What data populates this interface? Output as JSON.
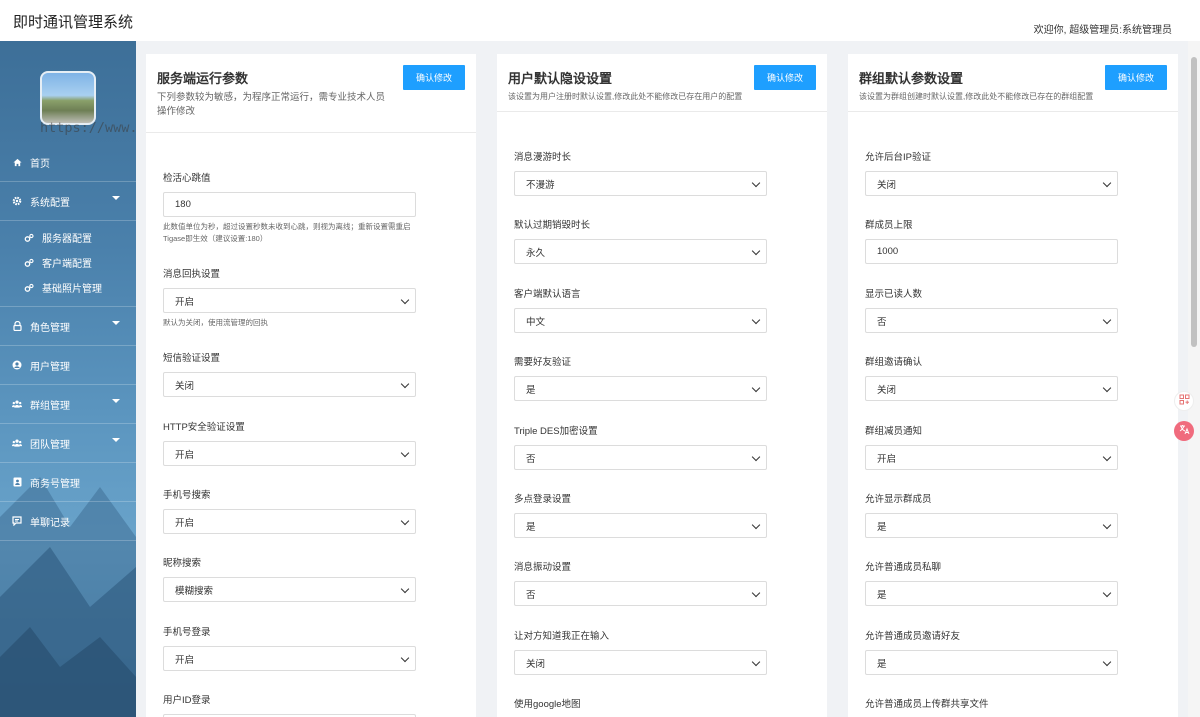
{
  "header": {
    "app_title": "即时通讯管理系统",
    "welcome": "欢迎你,  超级管理员:系统管理员"
  },
  "sidebar": {
    "watermark": "https://www.huzhan.com/ishop47990",
    "items": [
      {
        "label": "首页",
        "icon": "home-icon"
      },
      {
        "label": "系统配置",
        "icon": "gear-icon",
        "expanded": true
      },
      {
        "label": "角色管理",
        "icon": "lock-icon"
      },
      {
        "label": "用户管理",
        "icon": "user-icon"
      },
      {
        "label": "群组管理",
        "icon": "group-icon"
      },
      {
        "label": "团队管理",
        "icon": "team-icon"
      },
      {
        "label": "商务号管理",
        "icon": "contact-card-icon"
      },
      {
        "label": "单聊记录",
        "icon": "chat-icon"
      }
    ],
    "sub_items": [
      {
        "label": "服务器配置",
        "icon": "cogs-icon"
      },
      {
        "label": "客户端配置",
        "icon": "cogs-icon"
      },
      {
        "label": "基础照片管理",
        "icon": "cogs-icon"
      }
    ]
  },
  "panels": [
    {
      "title": "服务端运行参数",
      "desc": "下列参数较为敏感，为程序正常运行，需专业技术人员操作修改",
      "button": "确认修改",
      "fields": [
        {
          "label": "检活心跳值",
          "type": "input",
          "value": "180",
          "hint": "此数值单位为秒，超过设置秒数未收到心跳，则视为离线；重新设置需重启Tigase即生效（建议设置:180）"
        },
        {
          "label": "消息回执设置",
          "type": "select",
          "value": "开启",
          "hint": "默认为关闭，使用流管理的回执"
        },
        {
          "label": "短信验证设置",
          "type": "select",
          "value": "关闭"
        },
        {
          "label": "HTTP安全验证设置",
          "type": "select",
          "value": "开启"
        },
        {
          "label": "手机号搜索",
          "type": "select",
          "value": "开启"
        },
        {
          "label": "昵称搜索",
          "type": "select",
          "value": "模糊搜索"
        },
        {
          "label": "手机号登录",
          "type": "select",
          "value": "开启"
        },
        {
          "label": "用户ID登录",
          "type": "select",
          "value": ""
        }
      ]
    },
    {
      "title": "用户默认隐设设置",
      "desc": "该设置为用户注册时默认设置,修改此处不能修改已存在用户的配置",
      "button": "确认修改",
      "fields": [
        {
          "label": "消息漫游时长",
          "type": "select",
          "value": "不漫游"
        },
        {
          "label": "默认过期销毁时长",
          "type": "select",
          "value": "永久"
        },
        {
          "label": "客户端默认语言",
          "type": "select",
          "value": "中文"
        },
        {
          "label": "需要好友验证",
          "type": "select",
          "value": "是"
        },
        {
          "label": "Triple DES加密设置",
          "type": "select",
          "value": "否"
        },
        {
          "label": "多点登录设置",
          "type": "select",
          "value": "是"
        },
        {
          "label": "消息振动设置",
          "type": "select",
          "value": "否"
        },
        {
          "label": "让对方知道我正在输入",
          "type": "select",
          "value": "关闭"
        },
        {
          "label": "使用google地图",
          "type": "select",
          "value": ""
        }
      ]
    },
    {
      "title": "群组默认参数设置",
      "desc": "该设置为群组创建时默认设置,修改此处不能修改已存在的群组配置",
      "button": "确认修改",
      "fields": [
        {
          "label": "允许后台IP验证",
          "type": "select",
          "value": "关闭"
        },
        {
          "label": "群成员上限",
          "type": "input",
          "value": "1000"
        },
        {
          "label": "显示已读人数",
          "type": "select",
          "value": "否"
        },
        {
          "label": "群组邀请确认",
          "type": "select",
          "value": "关闭"
        },
        {
          "label": "群组减员通知",
          "type": "select",
          "value": "开启"
        },
        {
          "label": "允许显示群成员",
          "type": "select",
          "value": "是"
        },
        {
          "label": "允许普通成员私聊",
          "type": "select",
          "value": "是"
        },
        {
          "label": "允许普通成员邀请好友",
          "type": "select",
          "value": "是"
        },
        {
          "label": "允许普通成员上传群共享文件",
          "type": "select",
          "value": ""
        }
      ]
    }
  ],
  "colors": {
    "accent": "#1e9fff",
    "sidebar_top": "#3d6f98",
    "sidebar_bottom": "#4f88b3"
  }
}
